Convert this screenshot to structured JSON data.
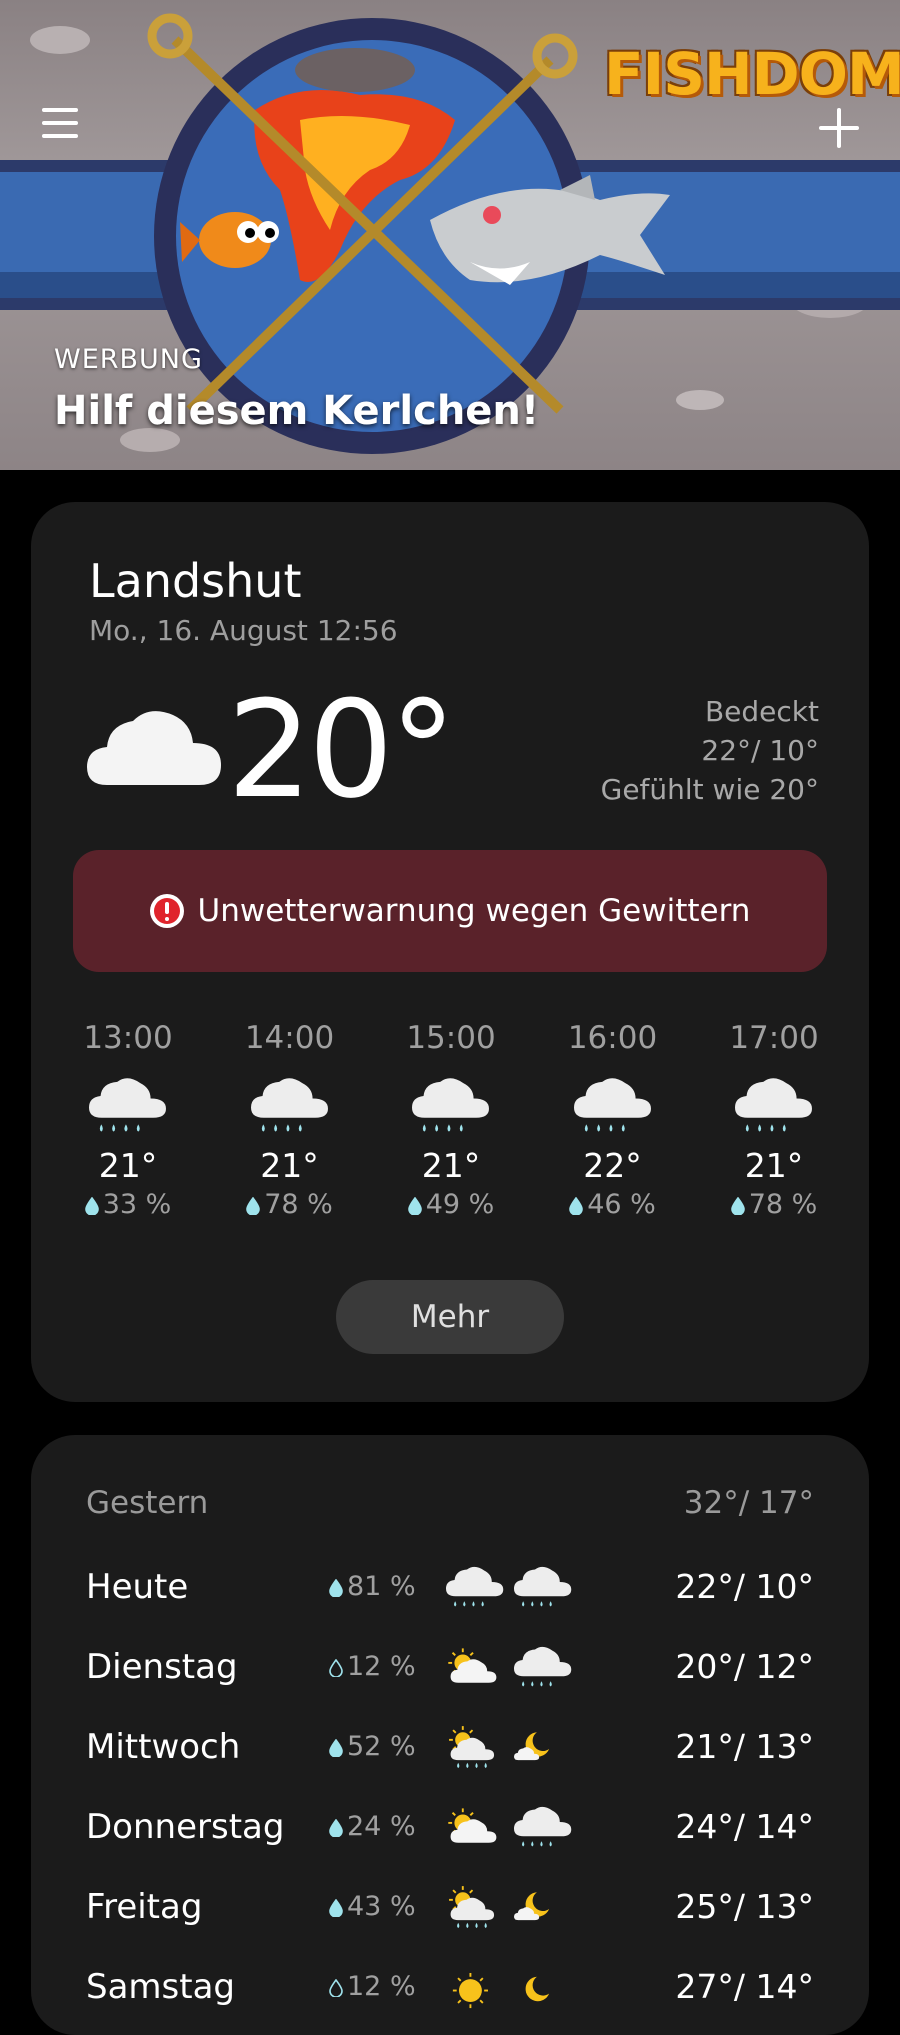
{
  "banner": {
    "menu_icon": "hamburger-menu-icon",
    "add_icon": "plus-icon",
    "logo_text": "FISHDOM",
    "ad_label": "WERBUNG",
    "ad_title": "Hilf diesem Kerlchen!"
  },
  "current": {
    "city": "Landshut",
    "datetime": "Mo., 16. August 12:56",
    "temperature": "20°",
    "condition": "Bedeckt",
    "high_low": "22°/ 10°",
    "feels_like": "Gefühlt wie 20°",
    "icon": "cloud-icon"
  },
  "alert": {
    "text": "Unwetterwarnung wegen Gewittern",
    "icon": "exclamation-icon",
    "color": "#5a222a"
  },
  "hourly": [
    {
      "time": "13:00",
      "temp": "21°",
      "precip": "33 %",
      "icon": "rain-icon"
    },
    {
      "time": "14:00",
      "temp": "21°",
      "precip": "78 %",
      "icon": "rain-icon"
    },
    {
      "time": "15:00",
      "temp": "21°",
      "precip": "49 %",
      "icon": "rain-icon"
    },
    {
      "time": "16:00",
      "temp": "22°",
      "precip": "46 %",
      "icon": "rain-icon"
    },
    {
      "time": "17:00",
      "temp": "21°",
      "precip": "78 %",
      "icon": "rain-icon"
    }
  ],
  "more_label": "Mehr",
  "daily": {
    "yesterday": {
      "label": "Gestern",
      "high_low": "32°/ 17°"
    },
    "rows": [
      {
        "day": "Heute",
        "precip": "81 %",
        "day_icon": "rain-icon",
        "night_icon": "rain-icon",
        "high_low": "22°/ 10°"
      },
      {
        "day": "Dienstag",
        "precip": "12 %",
        "day_icon": "partly-cloudy-icon",
        "night_icon": "rain-icon",
        "high_low": "20°/ 12°"
      },
      {
        "day": "Mittwoch",
        "precip": "52 %",
        "day_icon": "sun-rain-icon",
        "night_icon": "moon-cloud-icon",
        "high_low": "21°/ 13°"
      },
      {
        "day": "Donnerstag",
        "precip": "24 %",
        "day_icon": "partly-cloudy-icon",
        "night_icon": "rain-icon",
        "high_low": "24°/ 14°"
      },
      {
        "day": "Freitag",
        "precip": "43 %",
        "day_icon": "sun-rain-icon",
        "night_icon": "moon-cloud-icon",
        "high_low": "25°/ 13°"
      },
      {
        "day": "Samstag",
        "precip": "12 %",
        "day_icon": "sun-icon",
        "night_icon": "moon-icon",
        "high_low": "27°/ 14°"
      }
    ]
  },
  "colors": {
    "background": "#000000",
    "card": "#1b1b1b",
    "drop": "#9fe3ec",
    "sun": "#f7c21b"
  }
}
